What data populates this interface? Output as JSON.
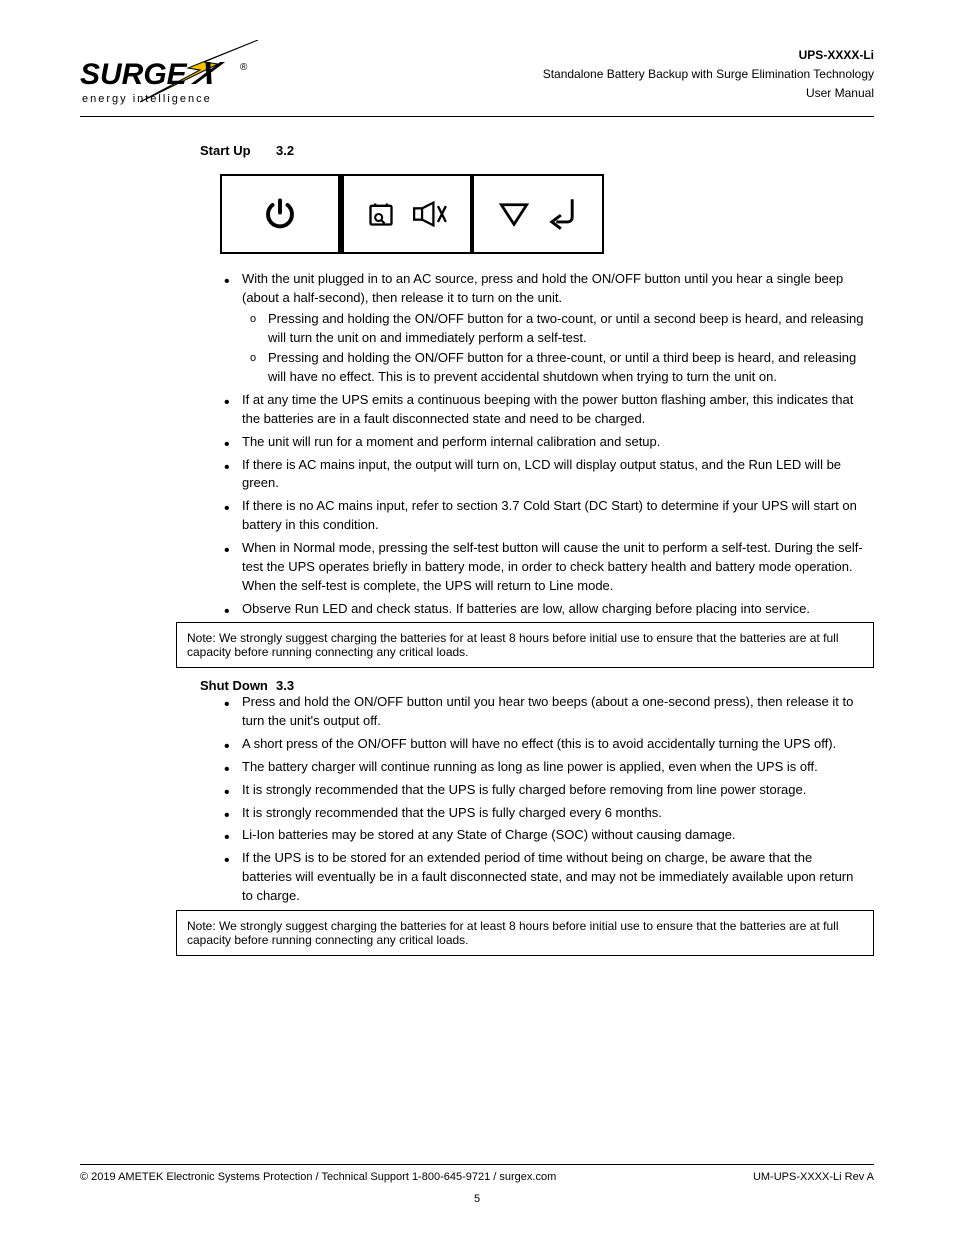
{
  "logo": {
    "brand_main": "SURGE",
    "brand_x": "X",
    "reg": "®",
    "tagline": "energy intelligence"
  },
  "header": {
    "model_prefix": "UPS-",
    "model_suffix": "-Li",
    "line2": "Standalone Battery Backup with Surge Elimination Technology",
    "line3": "User Manual"
  },
  "sections": {
    "num1": "3.2",
    "title1": "Start Up",
    "diagram_icons": [
      "power-icon",
      "self-test-icon",
      "mute-icon",
      "down-icon",
      "enter-icon"
    ],
    "startup_items": [
      {
        "text": "With the unit plugged in to an AC source, press and hold the ON/OFF button until you hear a single beep (about a half-second), then release it to turn on the unit.",
        "sub": [
          "Pressing and holding the ON/OFF button for a two-count, or until a second beep is heard, and releasing will turn the unit on and immediately perform a self-test.",
          "Pressing and holding the ON/OFF button for a three-count, or until a third beep is heard, and releasing will have no effect. This is to prevent accidental shutdown when trying to turn the unit on."
        ]
      },
      {
        "text": "If at any time the UPS emits a continuous beeping with the power button flashing amber, this indicates that the batteries are in a fault disconnected state and need to be charged."
      },
      {
        "text": "The unit will run for a moment and perform internal calibration and setup."
      },
      {
        "text": "If there is AC mains input, the output will turn on, LCD will display output status, and the Run LED will be green."
      },
      {
        "text": "If there is no AC mains input, refer to section 3.7 Cold Start (DC Start) to determine if your UPS will start on battery in this condition."
      },
      {
        "text": "When in Normal mode, pressing the self-test button will cause the unit to perform a self-test. During the self-test the UPS operates briefly in battery mode, in order to check battery health and battery mode operation. When the self-test is complete, the UPS will return to Line mode."
      },
      {
        "text": "Observe Run LED and check status. If batteries are low, allow charging before placing into service."
      }
    ],
    "notebox1": "Note: We strongly suggest charging the batteries for at least 8 hours before initial use to ensure that the batteries are at full capacity before running connecting any critical loads.",
    "num2": "3.3",
    "title2": "Shut Down",
    "shutdown_items": [
      {
        "text": "Press and hold the ON/OFF button until you hear two beeps (about a one-second press), then release it to turn the unit's output off."
      },
      {
        "text": "A short press of the ON/OFF button will have no effect (this is to avoid accidentally turning the UPS off)."
      },
      {
        "text": "The battery charger will continue running as long as line power is applied, even when the UPS is off."
      },
      {
        "text": "It is strongly recommended that the UPS is fully charged before removing from line power storage."
      },
      {
        "text": "It is strongly recommended that the UPS is fully charged every 6 months."
      },
      {
        "text": "Li-Ion batteries may be stored at any State of Charge (SOC) without causing damage."
      },
      {
        "text": "If the UPS is to be stored for an extended period of time without being on charge, be aware that the batteries will eventually be in a fault disconnected state, and may not be immediately available upon return to charge."
      }
    ],
    "notebox2": "Note: We strongly suggest charging the batteries for at least 8 hours before initial use to ensure that the batteries are at full capacity before running connecting any critical loads."
  },
  "footer": {
    "left": "© 2019 AMETEK Electronic Systems Protection / Technical Support 1-800-645-9721 / surgex.com",
    "right_prefix": "UM-UPS-",
    "right_suffix": "-Li Rev A",
    "page_label": "5"
  }
}
